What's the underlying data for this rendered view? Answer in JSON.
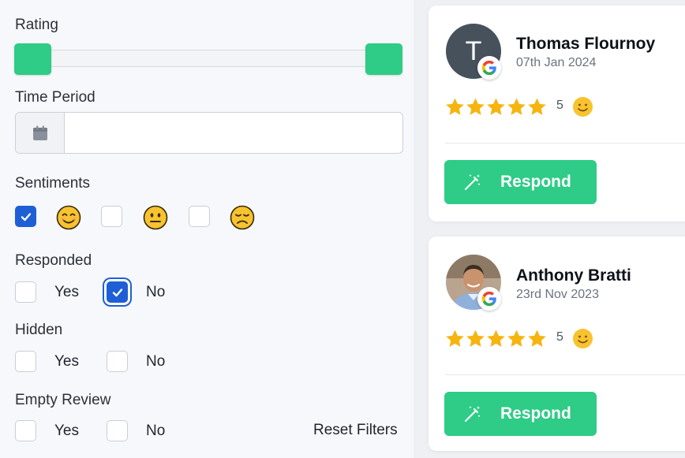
{
  "filters": {
    "rating_label": "Rating",
    "time_period_label": "Time Period",
    "time_period_value": "",
    "sentiments_label": "Sentiments",
    "sentiments": [
      {
        "icon": "smiling-emoji-icon",
        "checked": true
      },
      {
        "icon": "neutral-emoji-icon",
        "checked": false
      },
      {
        "icon": "sad-emoji-icon",
        "checked": false
      }
    ],
    "responded_label": "Responded",
    "responded": {
      "yes_label": "Yes",
      "no_label": "No",
      "yes_checked": false,
      "no_checked": true
    },
    "hidden_label": "Hidden",
    "hidden": {
      "yes_label": "Yes",
      "no_label": "No",
      "yes_checked": false,
      "no_checked": false
    },
    "empty_review_label": "Empty Review",
    "empty_review": {
      "yes_label": "Yes",
      "no_label": "No",
      "yes_checked": false,
      "no_checked": false
    },
    "reset_label": "Reset Filters"
  },
  "reviews": [
    {
      "avatar_letter": "T",
      "name": "Thomas Flournoy",
      "date": "07th Jan 2024",
      "stars": 5,
      "rating": "5",
      "source_icon": "google-icon",
      "respond_label": "Respond"
    },
    {
      "avatar_letter": "",
      "name": "Anthony Bratti",
      "date": "23rd Nov 2023",
      "stars": 5,
      "rating": "5",
      "source_icon": "google-icon",
      "respond_label": "Respond"
    }
  ],
  "colors": {
    "accent_green": "#2ecc86",
    "checkbox_blue": "#1f5fd6",
    "star_yellow": "#f6b40e"
  }
}
